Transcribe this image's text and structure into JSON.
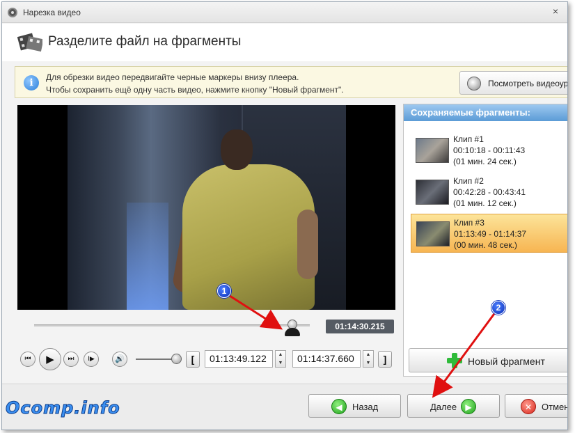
{
  "window": {
    "title": "Нарезка видео",
    "close_glyph": "×"
  },
  "header": {
    "title": "Разделите файл на фрагменты",
    "icon": "film-scissors-icon"
  },
  "info": {
    "line1": "Для обрезки видео передвигайте черные маркеры внизу плеера.",
    "line2": "Чтобы сохранить ещё одну часть видео, нажмите кнопку \"Новый фрагмент\".",
    "watch_button_label": "Посмотреть видеоурок"
  },
  "player": {
    "current_time": "01:14:30.215",
    "start_time": "01:13:49.122",
    "end_time": "01:14:37.660",
    "seek_position_fraction": 0.92,
    "volume_fraction": 0.88,
    "controls": {
      "prev_glyph": "⏮",
      "play_glyph": "▶",
      "next_glyph": "⏭",
      "frame_glyph": "I▶",
      "volume_glyph": "🔊",
      "mark_start_glyph": "[",
      "mark_end_glyph": "]",
      "spin_up": "▲",
      "spin_down": "▼"
    }
  },
  "fragments": {
    "header": "Сохраняемые фрагменты:",
    "clips": [
      {
        "name": "Клип #1",
        "range": "00:10:18 - 00:11:43",
        "duration": "(01 мин. 24 сек.)",
        "selected": false
      },
      {
        "name": "Клип #2",
        "range": "00:42:28 - 00:43:41",
        "duration": "(01 мин. 12 сек.)",
        "selected": false
      },
      {
        "name": "Клип #3",
        "range": "01:13:49 - 01:14:37",
        "duration": "(00 мин. 48 сек.)",
        "selected": true
      }
    ],
    "new_fragment_label": "Новый фрагмент"
  },
  "footer": {
    "back_label": "Назад",
    "next_label": "Далее",
    "cancel_label": "Отмена",
    "back_glyph": "◀",
    "next_glyph": "▶",
    "cancel_glyph": "✕"
  },
  "annotations": {
    "marker1": "1",
    "marker2": "2",
    "watermark": "Ocomp.info"
  },
  "colors": {
    "selected_clip": "#f7b552",
    "fragments_header": "#5b9bd6",
    "arrow": "#e01010",
    "marker": "#0a2fb8"
  }
}
